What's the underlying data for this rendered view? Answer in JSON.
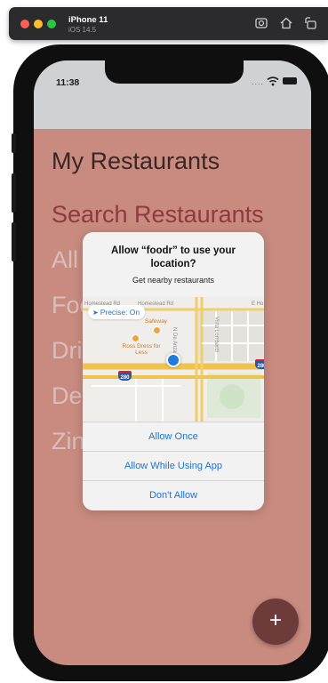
{
  "simulator": {
    "device_name": "iPhone 11",
    "os_version": "iOS 14.5",
    "icons": [
      "screenshot-icon",
      "home-icon",
      "rotate-icon"
    ]
  },
  "status_bar": {
    "time": "11:38",
    "signal": "....",
    "icons": [
      "wifi-icon",
      "battery-icon"
    ]
  },
  "menu": {
    "items": [
      {
        "label": "My Restaurants"
      },
      {
        "label": "Search Restaurants"
      },
      {
        "label": "All"
      },
      {
        "label": "Foo"
      },
      {
        "label": "Dri"
      },
      {
        "label": "De"
      },
      {
        "label": "Zin"
      }
    ]
  },
  "alert": {
    "title": "Allow “foodr” to use your location?",
    "message": "Get nearby restaurants",
    "precise_label": "Precise: On",
    "map": {
      "road_top_left": "Homestead Rd",
      "road_top_mid": "Homestead Rd",
      "road_top_right": "E Ho",
      "road_vertical": "N De Anza Blvd",
      "road_vertical_2": "Vista Lombardi",
      "poi_1": "Safeway",
      "poi_2": "Ross Dress for Less",
      "highway": "280"
    },
    "buttons": [
      {
        "label": "Allow Once"
      },
      {
        "label": "Allow While Using App"
      },
      {
        "label": "Don't Allow"
      }
    ]
  },
  "fab": {
    "label": "+"
  },
  "colors": {
    "screen_bg": "#c98b7f",
    "title_text": "#3b2624",
    "active_item": "#8e3a3f",
    "inactive_item": "#d9bfba",
    "fab_bg": "#6e3b3b",
    "ios_blue": "#1f72d8"
  }
}
